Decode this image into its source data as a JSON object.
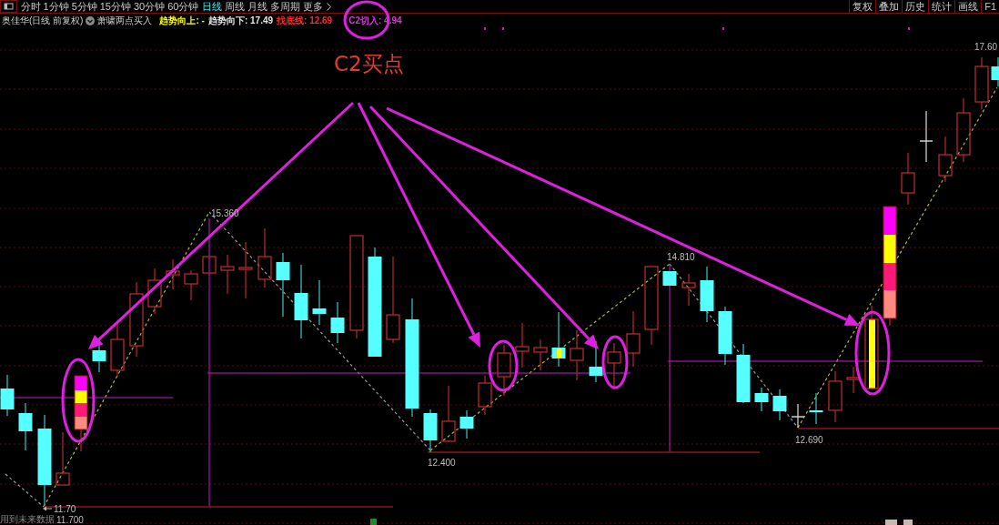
{
  "toolbar": {
    "period_tabs": [
      {
        "label": "分时",
        "selected": false
      },
      {
        "label": "1分钟",
        "selected": false
      },
      {
        "label": "5分钟",
        "selected": false
      },
      {
        "label": "15分钟",
        "selected": false
      },
      {
        "label": "30分钟",
        "selected": false
      },
      {
        "label": "60分钟",
        "selected": false
      },
      {
        "label": "日线",
        "selected": true
      },
      {
        "label": "周线",
        "selected": false
      },
      {
        "label": "月线",
        "selected": false
      },
      {
        "label": "多周期",
        "selected": false
      },
      {
        "label": "更多",
        "selected": false
      }
    ],
    "tools": [
      "复权",
      "叠加",
      "历史",
      "统计",
      "画线",
      "F1"
    ]
  },
  "info_bar": {
    "title": "奥佳华(日线 前复权)",
    "indicator": "萧啸两点买入",
    "readouts": [
      {
        "label": "趋势向上: -",
        "color": "#ffff00"
      },
      {
        "label": "趋势向下: 17.49",
        "color": "#e6e6e6"
      },
      {
        "label": "找底线: 12.69",
        "color": "#ff2a2a"
      },
      {
        "label": "C2切入: 4.94",
        "color": "#d23cd2"
      }
    ]
  },
  "chart": {
    "annotation": "C2买点",
    "price_labels": [
      "15.360",
      "14.810",
      "12.400",
      "12.690",
      "17.60",
      "11.70",
      "11.700"
    ],
    "note": "用到未来数据"
  }
}
